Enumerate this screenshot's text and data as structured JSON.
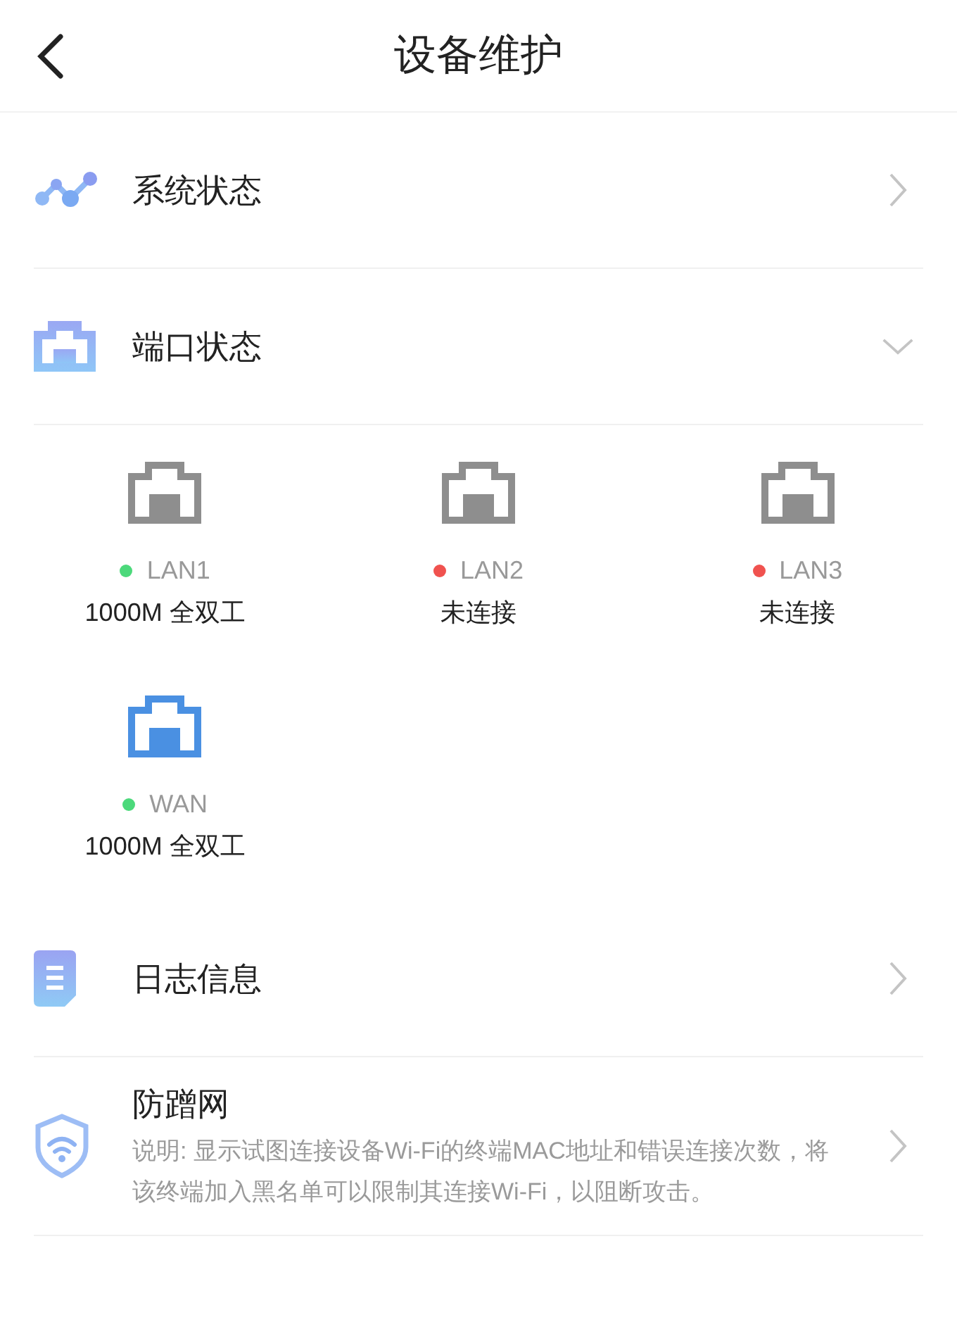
{
  "header": {
    "title": "设备维护"
  },
  "sections": [
    {
      "kind": "status",
      "label": "系统状态",
      "expanded": false
    },
    {
      "kind": "ports",
      "label": "端口状态",
      "expanded": true,
      "ports": [
        {
          "name": "LAN1",
          "kind": "lan",
          "color": "#4cd97b",
          "status": "1000M 全双工"
        },
        {
          "name": "LAN2",
          "kind": "lan",
          "color": "#f0524f",
          "status": "未连接"
        },
        {
          "name": "LAN3",
          "kind": "lan",
          "color": "#f0524f",
          "status": "未连接"
        },
        {
          "name": "WAN",
          "kind": "wan",
          "color": "#4cd97b",
          "status": "1000M 全双工"
        }
      ]
    },
    {
      "kind": "log",
      "label": "日志信息",
      "expanded": false
    },
    {
      "kind": "shield",
      "label": "防蹭网",
      "expanded": false,
      "description": "说明: 显示试图连接设备Wi-Fi的终端MAC地址和错误连接次数，将该终端加入黑名单可以限制其连接Wi-Fi，以阻断攻击。"
    }
  ]
}
